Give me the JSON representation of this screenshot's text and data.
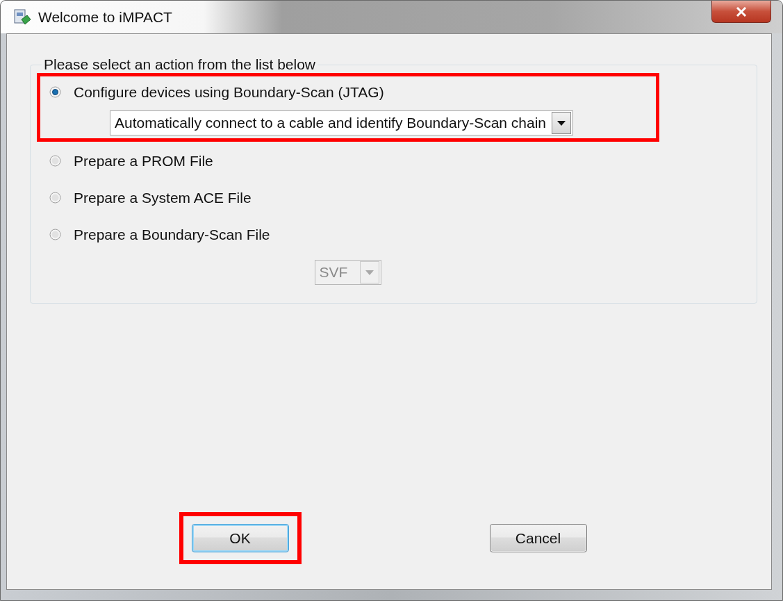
{
  "window": {
    "title": "Welcome to iMPACT"
  },
  "group": {
    "legend": "Please select an action from the list below"
  },
  "options": [
    {
      "label": "Configure devices using Boundary-Scan (JTAG)",
      "selected": true,
      "highlighted": true,
      "dropdown": {
        "kind": "wide",
        "value": "Automatically connect to a cable and identify Boundary-Scan chain",
        "disabled": false
      }
    },
    {
      "label": "Prepare a PROM File",
      "selected": false,
      "highlighted": false
    },
    {
      "label": "Prepare a System ACE File",
      "selected": false,
      "highlighted": false
    },
    {
      "label": "Prepare a Boundary-Scan File",
      "selected": false,
      "highlighted": false,
      "dropdown": {
        "kind": "compact",
        "value": "SVF",
        "disabled": true
      }
    }
  ],
  "buttons": [
    {
      "label": "OK",
      "highlighted": true,
      "focused": true
    },
    {
      "label": "Cancel",
      "highlighted": false,
      "focused": false
    }
  ]
}
